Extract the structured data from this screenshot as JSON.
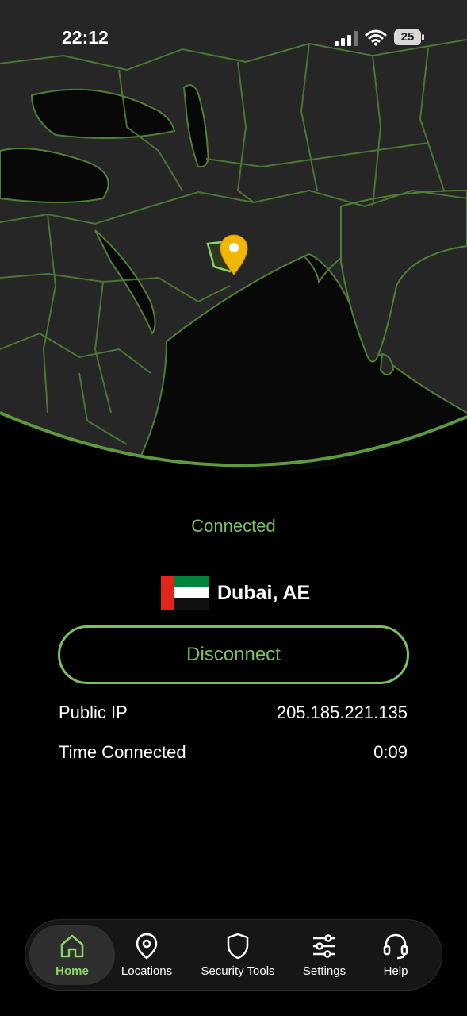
{
  "status_bar": {
    "time": "22:12",
    "battery": "25"
  },
  "connection": {
    "status": "Connected",
    "location": "Dubai, AE",
    "flag_icon": "uae-flag-icon"
  },
  "actions": {
    "disconnect_label": "Disconnect"
  },
  "details": [
    {
      "label": "Public IP",
      "value": "205.185.221.135"
    },
    {
      "label": "Time Connected",
      "value": "0:09"
    }
  ],
  "tabs": [
    {
      "label": "Home",
      "icon": "home-icon",
      "selected": true
    },
    {
      "label": "Locations",
      "icon": "location-pin-icon"
    },
    {
      "label": "Security Tools",
      "icon": "shield-icon"
    },
    {
      "label": "Settings",
      "icon": "sliders-icon"
    },
    {
      "label": "Help",
      "icon": "headset-icon"
    }
  ],
  "colors": {
    "accent": "#7cc062",
    "tab_selected": "#8dd36b",
    "pin": "#f2b705",
    "background": "#000000"
  }
}
